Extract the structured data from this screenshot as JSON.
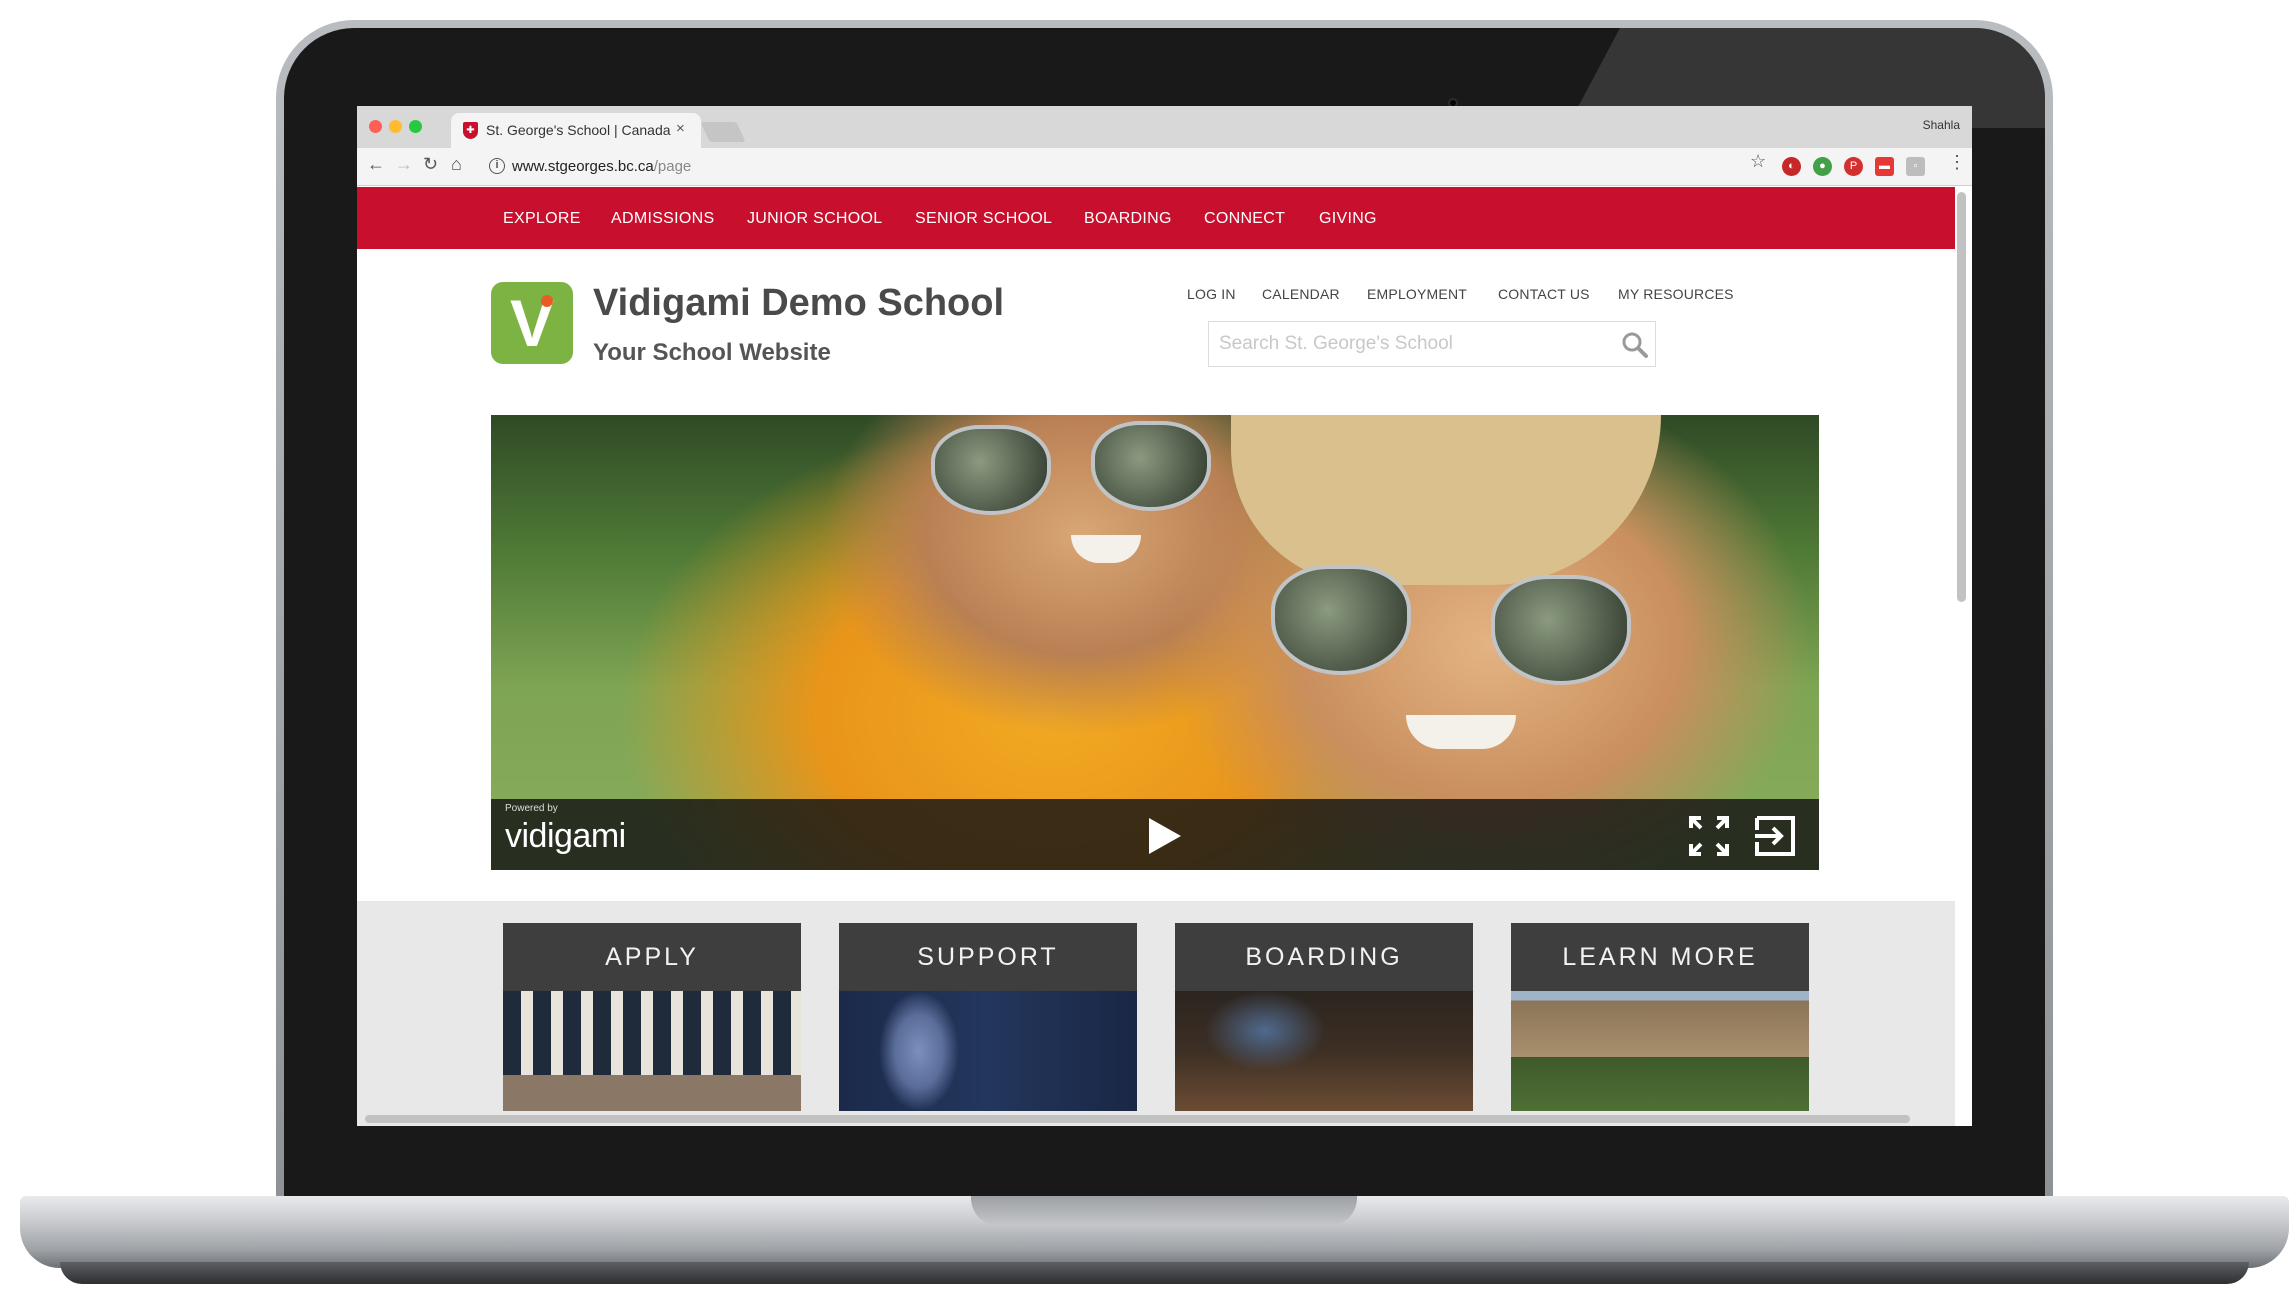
{
  "browser": {
    "tab_title": "St. George's School | Canada",
    "tab_close": "×",
    "profile_name": "Shahla",
    "url_host": "www.stgeorges.bc.ca",
    "url_path": "/page",
    "nav_icons": [
      "back-icon",
      "forward-icon",
      "reload-icon",
      "home-icon"
    ],
    "extension_icons": [
      "ext-red-icon",
      "ext-green-icon",
      "ext-pinterest-icon",
      "ext-red-square-icon",
      "ext-grey-icon"
    ],
    "traffic_light_colors": [
      "#ff5f57",
      "#febc2e",
      "#28c840"
    ]
  },
  "site": {
    "brand_color": "#c8102e",
    "topnav": [
      "EXPLORE",
      "ADMISSIONS",
      "JUNIOR SCHOOL",
      "SENIOR SCHOOL",
      "BOARDING",
      "CONNECT",
      "GIVING"
    ],
    "logo_letter": "V",
    "logo_color": "#7cb342",
    "title": "Vidigami Demo School",
    "subtitle": "Your School Website",
    "utility_links": [
      "LOG IN",
      "CALENDAR",
      "EMPLOYMENT",
      "CONTACT US",
      "MY RESOURCES"
    ],
    "search": {
      "placeholder": "Search St. George's School"
    }
  },
  "video": {
    "powered_by": "Powered by",
    "brand": "vidigami",
    "controls": [
      "play-icon",
      "fullscreen-icon",
      "exit-icon"
    ]
  },
  "tiles": [
    {
      "label": "APPLY"
    },
    {
      "label": "SUPPORT"
    },
    {
      "label": "BOARDING"
    },
    {
      "label": "LEARN MORE"
    }
  ]
}
